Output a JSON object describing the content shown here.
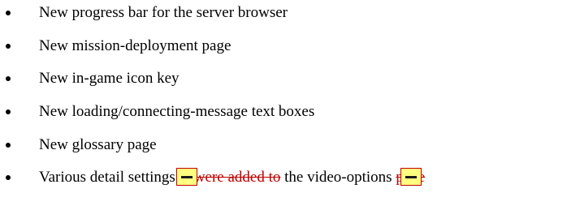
{
  "document": {
    "bullets": [
      {
        "text": "New progress bar for the server browser"
      },
      {
        "text": "New mission-deployment page"
      },
      {
        "text": "New in-game icon key"
      },
      {
        "text": "New loading/connecting-message text boxes"
      },
      {
        "text": "New glossary page"
      },
      {
        "text_start": "Various detail settings",
        "deleted": "were added to",
        "text_middle": "the video-options",
        "text_end": "page"
      }
    ]
  },
  "colors": {
    "deleted_text": "#c00000",
    "comment_marker_fill": "#ffff80",
    "comment_marker_border": "#c00000"
  }
}
